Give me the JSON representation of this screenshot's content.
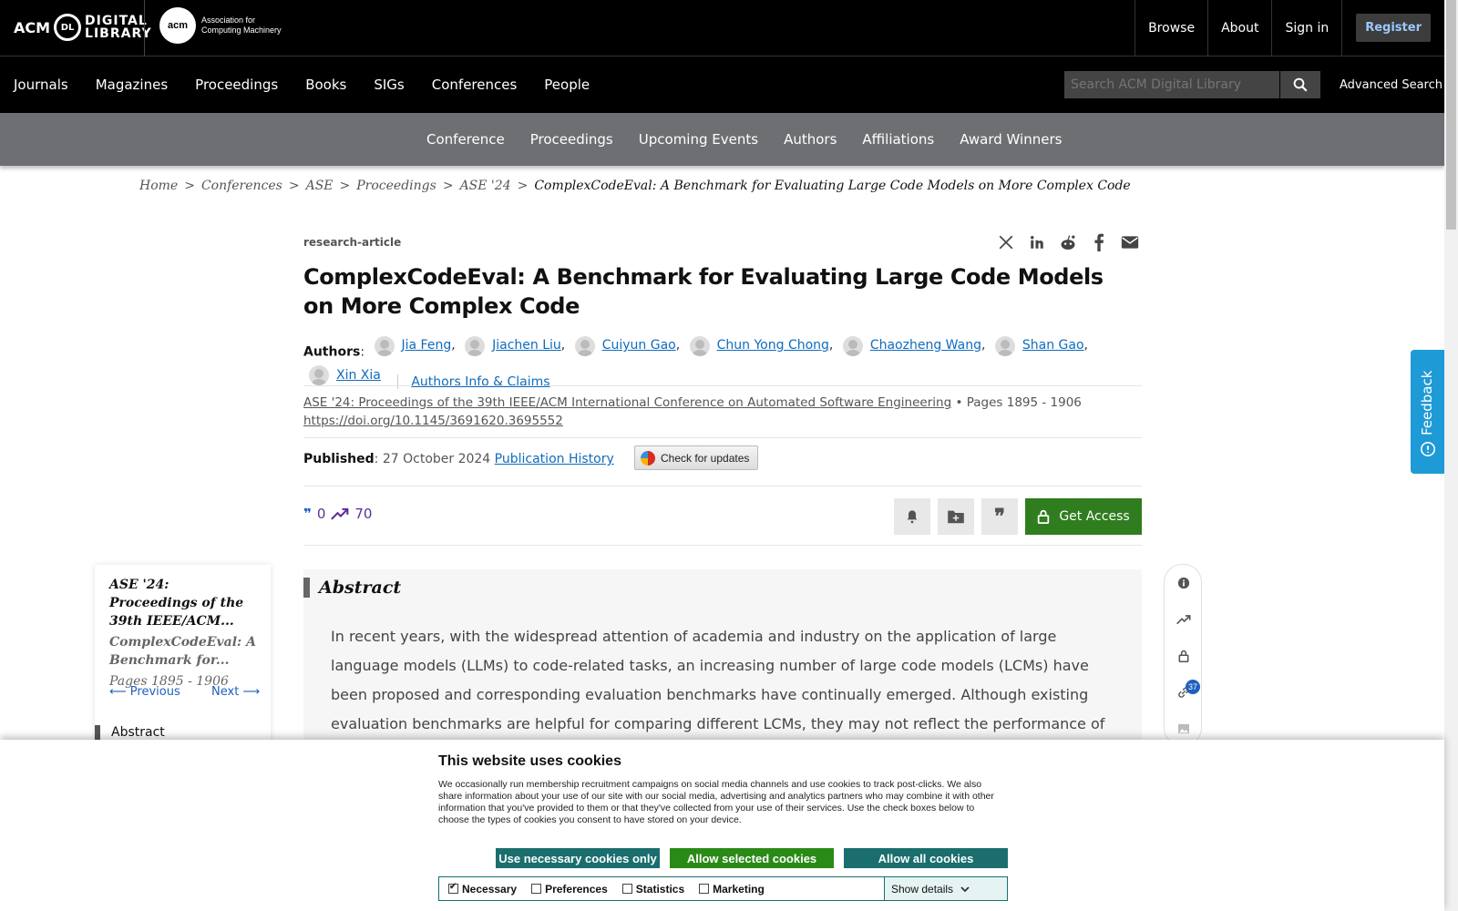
{
  "topbar": {
    "logo_acm": "ACM",
    "logo_dl_line1": "DIGITAL",
    "logo_dl_line2": "LIBRARY",
    "logo_org_line1": "Association for",
    "logo_org_line2": "Computing Machinery",
    "links": [
      "Browse",
      "About",
      "Sign in"
    ],
    "register": "Register"
  },
  "mainnav": {
    "items": [
      "Journals",
      "Magazines",
      "Proceedings",
      "Books",
      "SIGs",
      "Conferences",
      "People"
    ],
    "search_placeholder": "Search ACM Digital Library",
    "advanced_search": "Advanced Search"
  },
  "subnav": {
    "items": [
      "Conference",
      "Proceedings",
      "Upcoming Events",
      "Authors",
      "Affiliations",
      "Award Winners"
    ]
  },
  "breadcrumb": [
    "Home",
    "Conferences",
    "ASE",
    "Proceedings",
    "ASE '24",
    "ComplexCodeEval: A Benchmark for Evaluating Large Code Models on More Complex Code"
  ],
  "article": {
    "type": "research-article",
    "title": "ComplexCodeEval: A Benchmark for Evaluating Large Code Models on More Complex Code",
    "authors_label": "Authors",
    "authors": [
      "Jia Feng",
      "Jiachen Liu",
      "Cuiyun Gao",
      "Chun Yong Chong",
      "Chaozheng Wang",
      "Shan Gao",
      "Xin Xia"
    ],
    "authors_info": "Authors Info & Claims",
    "proceedings": "ASE '24: Proceedings of the 39th IEEE/ACM International Conference on Automated Software Engineering",
    "pages": "Pages 1895 - 1906",
    "doi": "https://doi.org/10.1145/3691620.3695552",
    "published_label": "Published",
    "published_date": "27 October 2024",
    "publication_history": "Publication History",
    "check_updates": "Check for updates",
    "citations": "0",
    "downloads": "70",
    "get_access": "Get Access"
  },
  "toc": {
    "proc_title": "ASE '24: Proceedings of the 39th IEEE/ACM...",
    "paper_title": "ComplexCodeEval: A Benchmark for...",
    "pages": "Pages 1895 - 1906",
    "previous": "Previous",
    "next": "Next",
    "section": "Abstract"
  },
  "abstract": {
    "heading": "Abstract",
    "text": "In recent years, with the widespread attention of academia and industry on the application of large language models (LLMs) to code-related tasks, an increasing number of large code models (LCMs) have been proposed and corresponding evaluation benchmarks have continually emerged. Although existing evaluation benchmarks are helpful for comparing different LCMs, they may not reflect the performance of LCMs in various development"
  },
  "rail": {
    "references_count": "37"
  },
  "feedback": "Feedback",
  "cookie": {
    "title": "This website uses cookies",
    "text": "We occasionally run membership recruitment campaigns on social media channels and use cookies to track post-clicks. We also share information about your use of our site with our social media, advertising and analytics partners who may combine it with other information that you've provided to them or that they've collected from your use of their services. Use the check boxes below to choose the types of cookies you consent to have stored on your device.",
    "btn_necessary": "Use necessary cookies only",
    "btn_selected": "Allow selected cookies",
    "btn_all": "Allow all cookies",
    "options": [
      "Necessary",
      "Preferences",
      "Statistics",
      "Marketing"
    ],
    "show_details": "Show details"
  },
  "colors": {
    "accent_link": "#0f6cbd",
    "get_access_green": "#2f7d1f",
    "cookie_teal": "#1a6e6e",
    "feedback_blue": "#1e9ad6"
  }
}
